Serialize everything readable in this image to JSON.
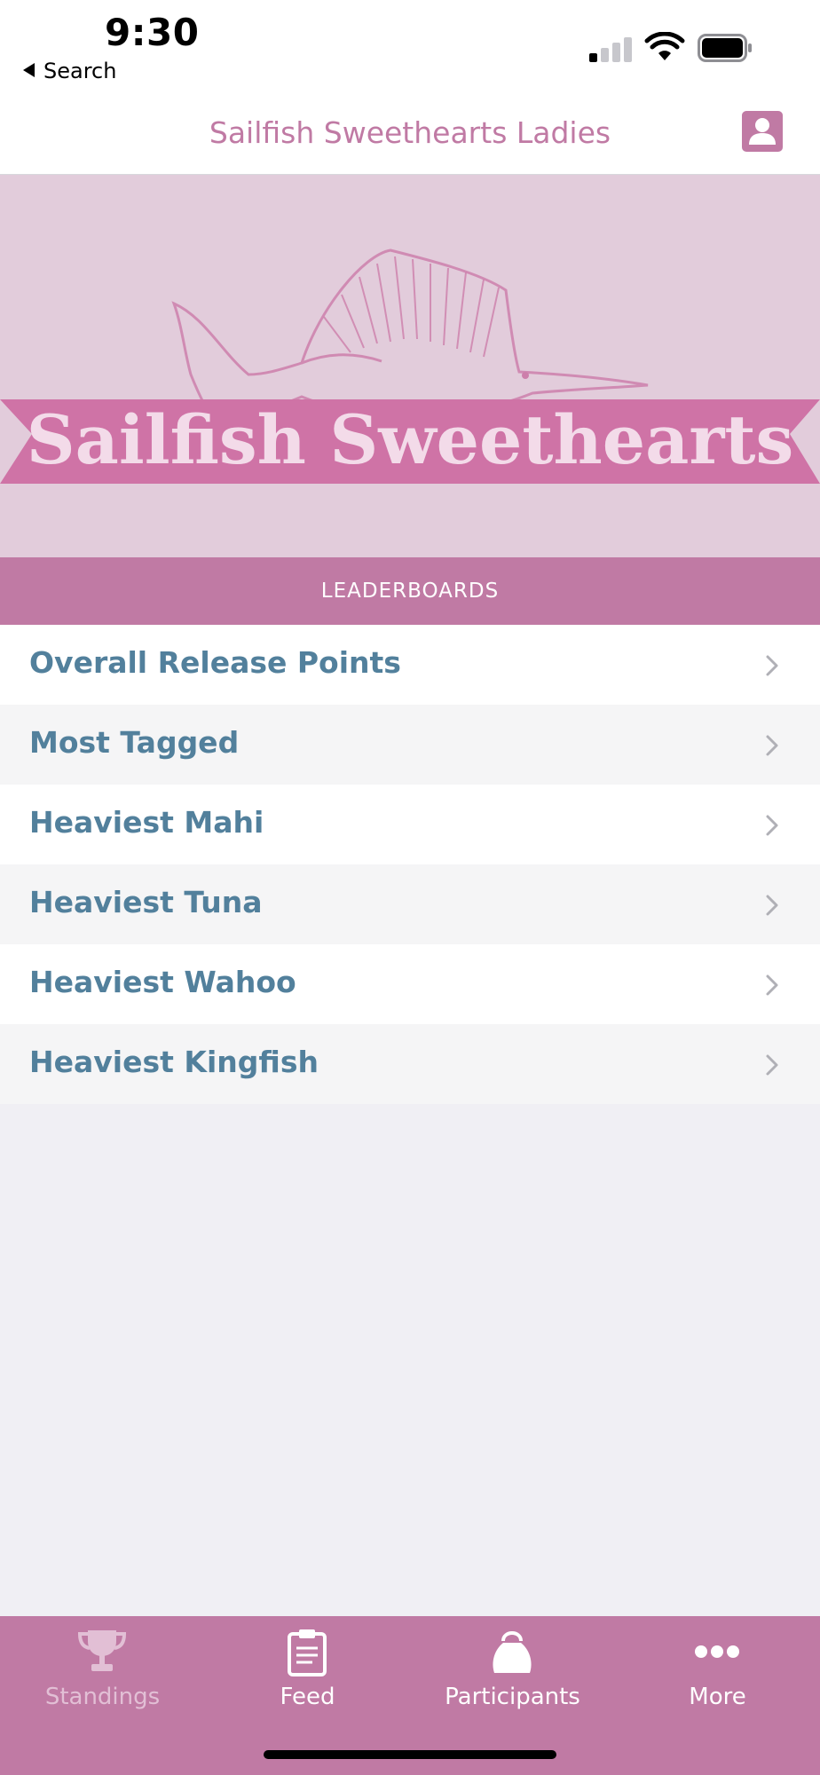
{
  "status_bar": {
    "time": "9:30",
    "back_label": "Search"
  },
  "header": {
    "title": "Sailfish Sweethearts Ladies",
    "profile_icon": "person-icon"
  },
  "banner": {
    "text": "Sailfish Sweethearts",
    "logo_icon": "sailfish-logo"
  },
  "section": {
    "label": "LEADERBOARDS"
  },
  "leaderboards": [
    {
      "label": "Overall Release Points"
    },
    {
      "label": "Most Tagged"
    },
    {
      "label": "Heaviest Mahi"
    },
    {
      "label": "Heaviest Tuna"
    },
    {
      "label": "Heaviest Wahoo"
    },
    {
      "label": "Heaviest Kingfish"
    }
  ],
  "tabs": [
    {
      "label": "Standings",
      "icon": "trophy-icon",
      "active": true
    },
    {
      "label": "Feed",
      "icon": "clipboard-icon",
      "active": false
    },
    {
      "label": "Participants",
      "icon": "participants-icon",
      "active": false
    },
    {
      "label": "More",
      "icon": "more-dots-icon",
      "active": false
    }
  ],
  "colors": {
    "accent": "#c07aa4",
    "banner_bg": "#e2ccdb",
    "list_text": "#52809c",
    "tab_inactive": "#e2bfd5",
    "tab_active": "#ffffff"
  }
}
